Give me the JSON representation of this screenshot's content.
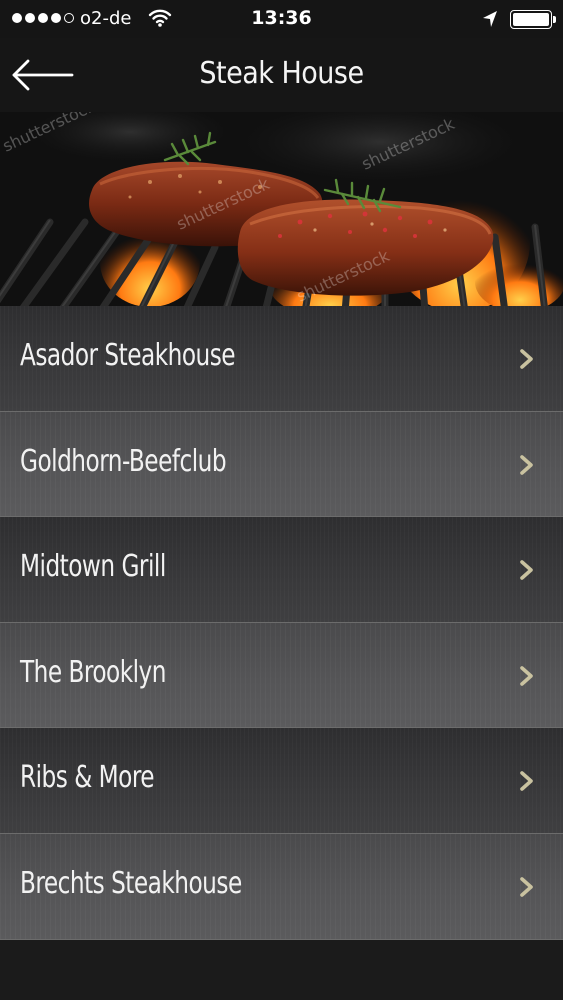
{
  "status_bar": {
    "carrier": "o2-de",
    "time": "13:36",
    "signal_bars_filled": 4,
    "signal_bars_total": 5,
    "battery_level": 1.0
  },
  "nav": {
    "title": "Steak House",
    "back_icon": "back-arrow-icon"
  },
  "hero": {
    "watermark": "shutterstock"
  },
  "restaurants": [
    {
      "name": "Asador Steakhouse"
    },
    {
      "name": "Goldhorn-Beefclub"
    },
    {
      "name": "Midtown Grill"
    },
    {
      "name": "The Brooklyn"
    },
    {
      "name": "Ribs & More"
    },
    {
      "name": "Brechts Steakhouse"
    }
  ],
  "colors": {
    "chevron": "#c9c2a0",
    "row_dark": "#343436",
    "row_light": "#525254",
    "text": "#f2f2f2"
  }
}
